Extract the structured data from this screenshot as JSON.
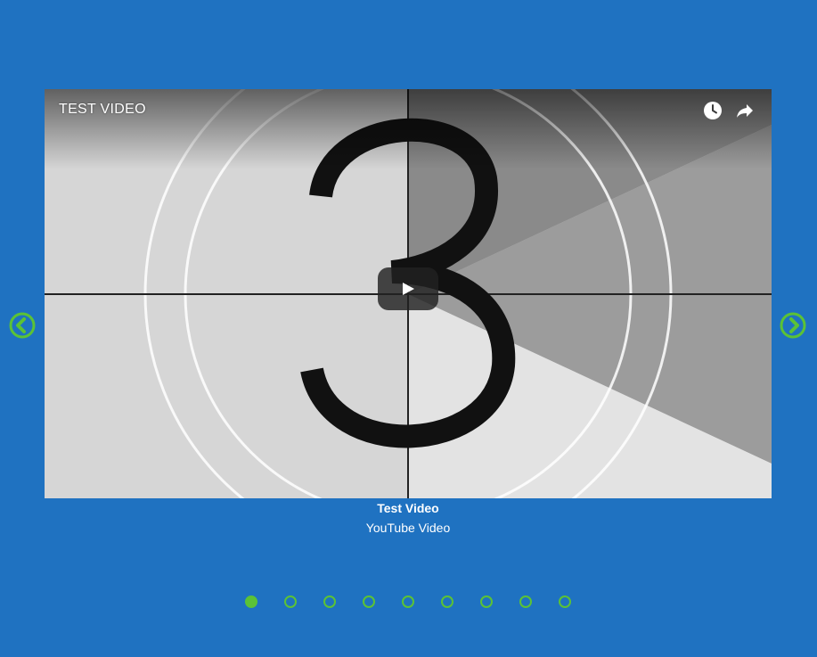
{
  "video": {
    "title": "TEST VIDEO",
    "watch_later_icon": "clock-icon",
    "share_icon": "share-arrow-icon",
    "play_icon": "play-icon"
  },
  "caption": {
    "title": "Test Video",
    "subtitle": "YouTube Video"
  },
  "navigation": {
    "prev_icon": "chevron-left-circle-icon",
    "next_icon": "chevron-right-circle-icon",
    "accent_color": "#5bc236"
  },
  "pagination": {
    "total": 9,
    "active_index": 0
  },
  "colors": {
    "background": "#1f72c1",
    "caption_text": "#ffffff"
  }
}
